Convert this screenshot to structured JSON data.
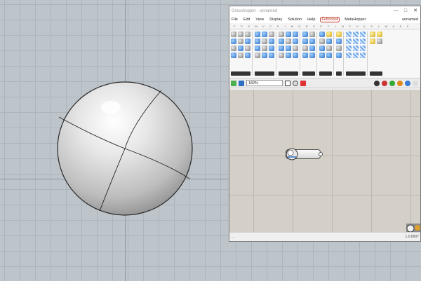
{
  "gh": {
    "title": "Grasshopper - unnamed",
    "doc_name": "unnamed",
    "menu": [
      "File",
      "Edit",
      "View",
      "Display",
      "Solution",
      "Help",
      "Fetlocked",
      "MetaHopper"
    ],
    "active_menu": "Fetlocked",
    "tab_keys": [
      "F",
      "P",
      "S",
      "M",
      "V",
      "C",
      "S",
      "I",
      "M",
      "D",
      "R",
      "S",
      "P",
      "T",
      "I",
      "N",
      "F",
      "H",
      "K",
      "P",
      "L",
      "W",
      "A",
      "E",
      "F"
    ],
    "zoom": "182%",
    "version": "1.0.0007",
    "status_left": "..."
  },
  "icons": {
    "gh_component": "sphere-component-icon",
    "save": "save-icon",
    "open": "open-file-icon",
    "eye": "preview-eye-icon",
    "paint": "paint-icon"
  },
  "colors": {
    "viewport_bg": "#bdc4ca",
    "canvas_bg": "#d4d0c8",
    "accent": "#2f6fc4"
  }
}
